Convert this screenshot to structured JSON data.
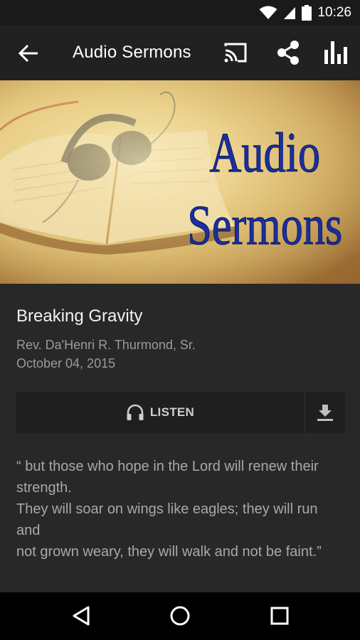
{
  "status_bar": {
    "time": "10:26",
    "icons": [
      "wifi-icon",
      "signal-icon",
      "battery-icon"
    ]
  },
  "app_bar": {
    "title": "Audio Sermons",
    "actions": [
      "back-arrow-icon",
      "cast-icon",
      "share-icon",
      "bar-chart-icon"
    ]
  },
  "hero": {
    "line1": "Audio",
    "line2": "Sermons",
    "text_color": "#1a2fa0"
  },
  "sermon": {
    "title": "Breaking Gravity",
    "speaker": "Rev. Da'Henri R. Thurmond, Sr.",
    "date": "October 04, 2015"
  },
  "actions": {
    "listen_label": "LISTEN",
    "listen_icon": "headphones-icon",
    "download_icon": "download-icon"
  },
  "quote_lines": [
    "“ but those who hope in the Lord will renew their strength.",
    "They will soar on wings like eagles; they will run and",
    "not grown weary, they will walk and not be faint.”"
  ],
  "nav_bar": [
    "back-triangle-icon",
    "home-circle-icon",
    "recents-square-icon"
  ]
}
